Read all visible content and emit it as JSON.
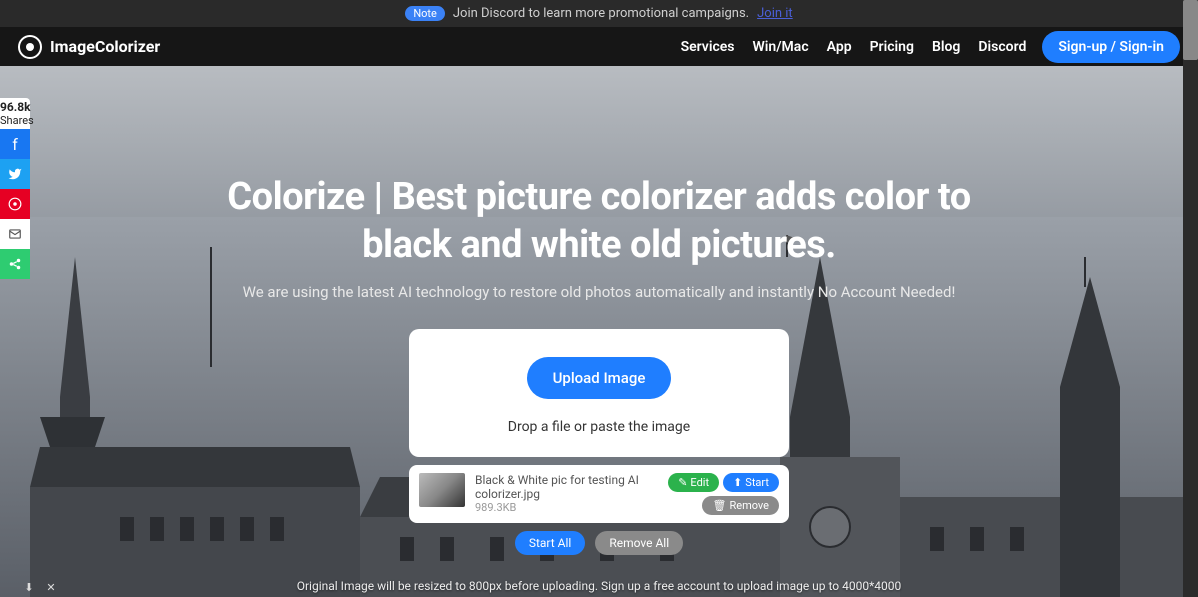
{
  "announce": {
    "badge": "Note",
    "text": "Join Discord to learn more promotional campaigns.",
    "link": "Join it"
  },
  "nav": {
    "brand": "ImageColorizer",
    "links": [
      "Services",
      "Win/Mac",
      "App",
      "Pricing",
      "Blog",
      "Discord"
    ],
    "signin": "Sign-up / Sign-in"
  },
  "share": {
    "count": "96.8k",
    "label": "Shares"
  },
  "hero": {
    "title_1": "Colorize | Best picture colorizer adds color to",
    "title_2": "black and white old pictures.",
    "subtitle": "We are using the latest AI technology to restore old photos automatically and instantly No Account Needed!"
  },
  "upload": {
    "button": "Upload Image",
    "hint": "Drop a file or paste the image"
  },
  "file": {
    "name": "Black & White pic for testing AI colorizer.jpg",
    "size": "989.3KB",
    "edit": "Edit",
    "start": "Start",
    "remove": "Remove"
  },
  "batch": {
    "start_all": "Start All",
    "remove_all": "Remove All"
  },
  "footnote": "Original Image will be resized to 800px before uploading. Sign up a free account to upload image up to 4000*4000"
}
